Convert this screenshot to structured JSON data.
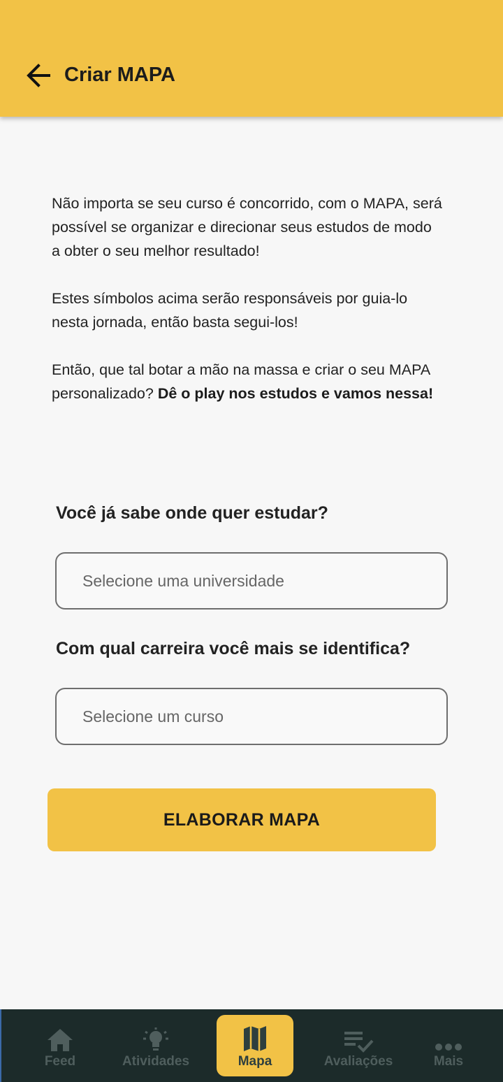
{
  "header": {
    "title": "Criar MAPA",
    "back_icon": "arrow-left-icon"
  },
  "intro": {
    "p1": "Não importa se seu curso é concorrido, com o MAPA, será possível se organizar e direcionar seus estudos de modo a obter o seu melhor resultado!",
    "p2": "Estes símbolos acima serão responsáveis por guia-lo nesta jornada, então basta segui-los!",
    "p3_regular": "Então, que tal botar a mão na massa e criar o seu MAPA personalizado? ",
    "p3_bold": "Dê o play nos estudos e vamos nessa!"
  },
  "form": {
    "university_question": "Você já sabe onde quer estudar?",
    "university_placeholder": "Selecione uma universidade",
    "career_question": "Com qual carreira você mais se identifica?",
    "career_placeholder": "Selecione um curso",
    "submit_label": "ELABORAR MAPA"
  },
  "bottom_nav": {
    "active": "Mapa",
    "items": [
      {
        "label": "Feed",
        "icon": "home-icon"
      },
      {
        "label": "Atividades",
        "icon": "lightbulb-icon"
      },
      {
        "label": "Mapa",
        "icon": "map-icon"
      },
      {
        "label": "Avaliações",
        "icon": "checklist-icon"
      },
      {
        "label": "Mais",
        "icon": "more-dots-icon"
      }
    ]
  },
  "colors": {
    "accent": "#f2c246",
    "nav_background": "#1c2b2a",
    "nav_inactive": "#4f5e5d",
    "text": "#222222"
  }
}
